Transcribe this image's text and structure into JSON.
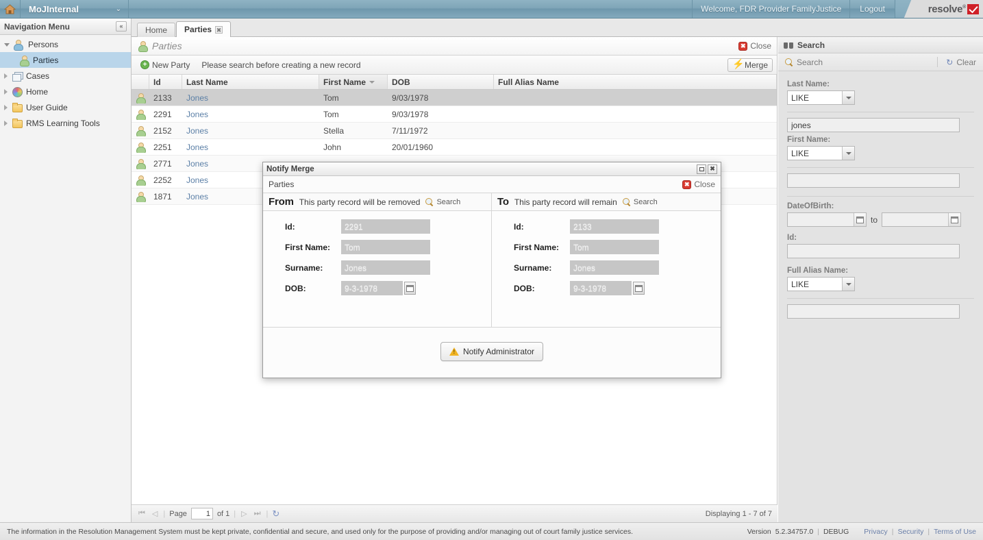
{
  "topbar": {
    "home_icon": "home-icon",
    "app_name": "MoJInternal",
    "chevron": "⌄",
    "welcome": "Welcome, FDR Provider FamilyJustice",
    "logout": "Logout",
    "brand": "resolve",
    "brand_trademark": "®"
  },
  "sidebar": {
    "header": "Navigation Menu",
    "collapse_icon": "«",
    "items": [
      {
        "label": "Persons",
        "icon": "persons-icon",
        "level": 0,
        "state": "open",
        "selected": false
      },
      {
        "label": "Parties",
        "icon": "person-icon",
        "level": 1,
        "state": "leaf",
        "selected": true
      },
      {
        "label": "Cases",
        "icon": "cases-icon",
        "level": 0,
        "state": "closed",
        "selected": false
      },
      {
        "label": "Home",
        "icon": "globe-icon",
        "level": 0,
        "state": "closed",
        "selected": false
      },
      {
        "label": "User Guide",
        "icon": "folder-icon",
        "level": 0,
        "state": "closed",
        "selected": false
      },
      {
        "label": "RMS Learning Tools",
        "icon": "folder-icon",
        "level": 0,
        "state": "closed",
        "selected": false
      }
    ]
  },
  "tabs": [
    {
      "label": "Home",
      "active": false,
      "closable": false
    },
    {
      "label": "Parties",
      "active": true,
      "closable": true,
      "close_glyph": "✖"
    }
  ],
  "page": {
    "title": "Parties",
    "title_icon": "person-icon",
    "close_label": "Close",
    "close_glyph": "✖"
  },
  "toolbar": {
    "new_party_label": "New Party",
    "new_party_glyph": "+",
    "hint": "Please search before creating a new record",
    "merge_label": "Merge",
    "merge_icon": "bolt-icon"
  },
  "grid": {
    "columns": [
      {
        "key": "icon",
        "label": "",
        "sorted": false
      },
      {
        "key": "id",
        "label": "Id",
        "sorted": false
      },
      {
        "key": "last",
        "label": "Last Name",
        "sorted": false
      },
      {
        "key": "first",
        "label": "First Name",
        "sorted": true
      },
      {
        "key": "dob",
        "label": "DOB",
        "sorted": false
      },
      {
        "key": "alias",
        "label": "Full Alias Name",
        "sorted": false
      }
    ],
    "rows": [
      {
        "id": "2133",
        "last": "Jones",
        "first": "Tom",
        "dob": "9/03/1978",
        "alias": "",
        "selected": true
      },
      {
        "id": "2291",
        "last": "Jones",
        "first": "Tom",
        "dob": "9/03/1978",
        "alias": "",
        "selected": false
      },
      {
        "id": "2152",
        "last": "Jones",
        "first": "Stella",
        "dob": "7/11/1972",
        "alias": "",
        "selected": false
      },
      {
        "id": "2251",
        "last": "Jones",
        "first": "John",
        "dob": "20/01/1960",
        "alias": "",
        "selected": false
      },
      {
        "id": "2771",
        "last": "Jones",
        "first": "",
        "dob": "",
        "alias": "",
        "selected": false
      },
      {
        "id": "2252",
        "last": "Jones",
        "first": "",
        "dob": "",
        "alias": "",
        "selected": false
      },
      {
        "id": "1871",
        "last": "Jones",
        "first": "",
        "dob": "",
        "alias": "",
        "selected": false
      }
    ]
  },
  "pager": {
    "first_glyph": "⏮",
    "prev_glyph": "◁",
    "page_label": "Page",
    "page_value": "1",
    "of_label": "of 1",
    "next_glyph": "▷",
    "last_glyph": "⏭",
    "refresh_glyph": "↻",
    "displaying": "Displaying 1 - 7 of 7"
  },
  "search_panel": {
    "header": "Search",
    "header_icon": "binoculars-icon",
    "search_label": "Search",
    "search_icon": "magnifier-icon",
    "clear_label": "Clear",
    "clear_icon": "refresh-icon",
    "fields": [
      {
        "label": "Last Name:",
        "operator": "LIKE",
        "value": "jones",
        "placeholder": "",
        "type": "text"
      },
      {
        "label": "First Name:",
        "operator": "LIKE",
        "value": "",
        "placeholder": "",
        "type": "text"
      },
      {
        "label": "DateOfBirth:",
        "operator": "",
        "from": "",
        "to": "",
        "to_word": "to",
        "type": "daterange"
      },
      {
        "label": "Id:",
        "operator": "",
        "value": "",
        "placeholder": "",
        "type": "text"
      },
      {
        "label": "Full Alias Name:",
        "operator": "LIKE",
        "value": "",
        "placeholder": "",
        "type": "text"
      }
    ]
  },
  "modal": {
    "title": "Notify Merge",
    "maximize_glyph": "□",
    "close_glyph": "✖",
    "subtitle": "Parties",
    "close_label": "Close",
    "close_icon_glyph": "✖",
    "from": {
      "heading": "From",
      "description": "This party record will be removed",
      "search_label": "Search",
      "fields": [
        {
          "label": "Id:",
          "value": "2291",
          "type": "text"
        },
        {
          "label": "First Name:",
          "value": "Tom",
          "type": "text"
        },
        {
          "label": "Surname:",
          "value": "Jones",
          "type": "text"
        },
        {
          "label": "DOB:",
          "value": "9-3-1978",
          "type": "date"
        }
      ]
    },
    "to": {
      "heading": "To",
      "description": "This party record will remain",
      "search_label": "Search",
      "fields": [
        {
          "label": "Id:",
          "value": "2133",
          "type": "text"
        },
        {
          "label": "First Name:",
          "value": "Tom",
          "type": "text"
        },
        {
          "label": "Surname:",
          "value": "Jones",
          "type": "text"
        },
        {
          "label": "DOB:",
          "value": "9-3-1978",
          "type": "date"
        }
      ]
    },
    "notify_button": "Notify Administrator",
    "notify_icon": "warning-icon"
  },
  "footer": {
    "disclaimer": "The information in the Resolution Management System must be kept private, confidential and secure, and used only for the purpose of providing and/or managing out of court family justice services.",
    "version_label": "Version",
    "version_value": "5.2.34757.0",
    "environment": "DEBUG",
    "links": [
      "Privacy",
      "Security",
      "Terms of Use"
    ]
  },
  "colors": {
    "topbar_accent": "#7fa5b8",
    "brand_red": "#cf2027",
    "selected_nav": "#b9d5ea",
    "selected_row": "#cfcfcf",
    "link_blue": "#5b7fa6",
    "panel_bg": "#e3e3e3"
  }
}
